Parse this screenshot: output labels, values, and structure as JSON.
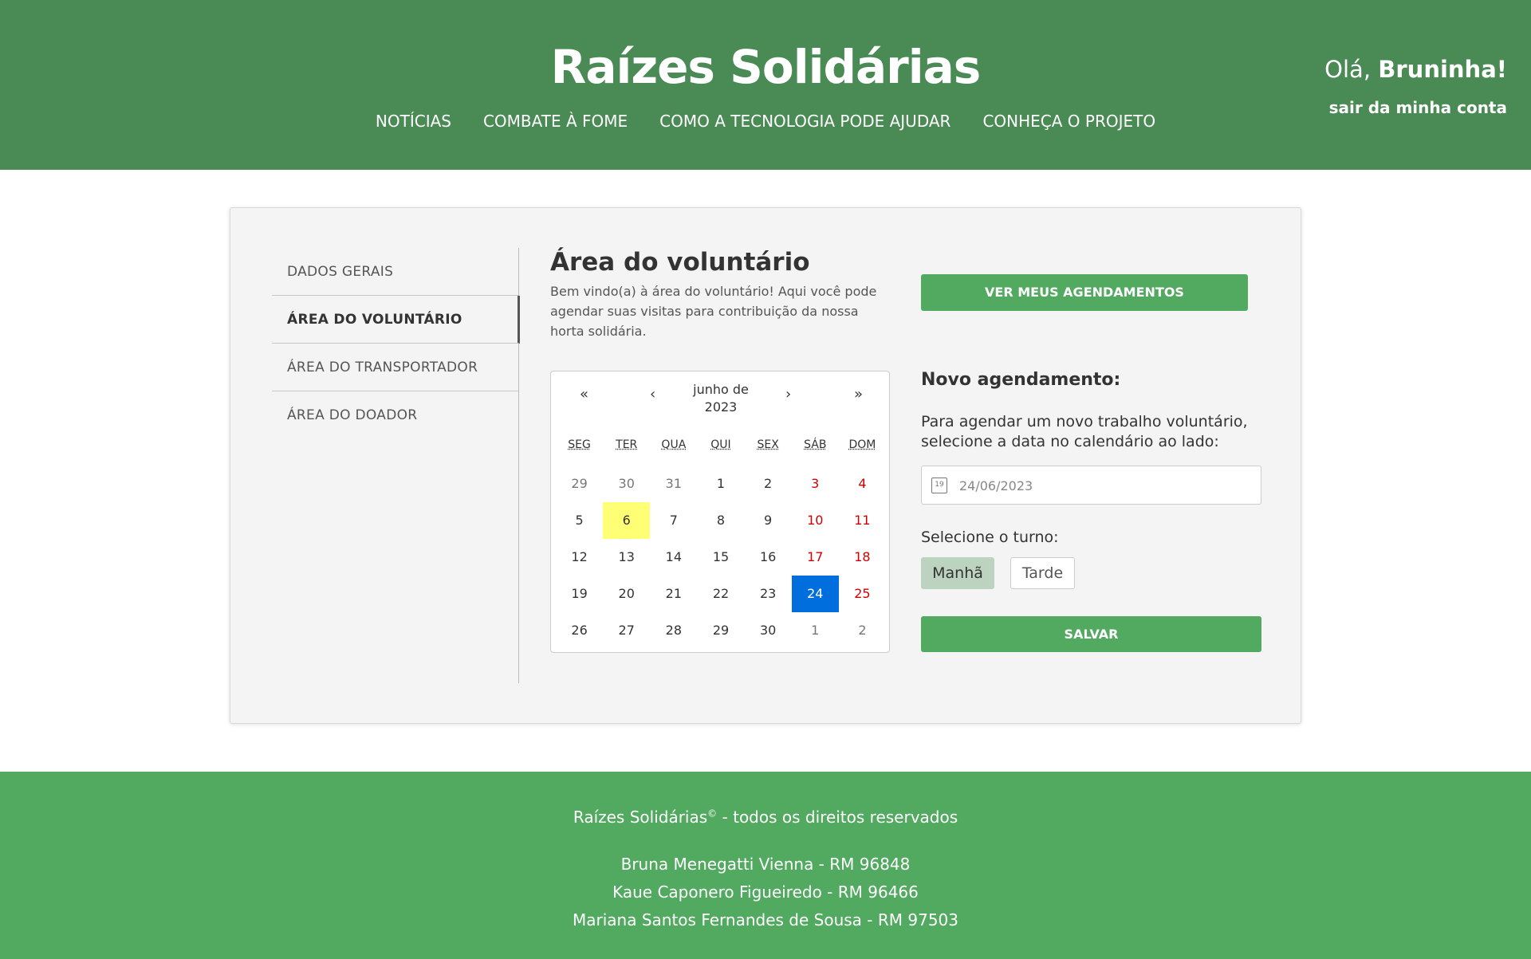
{
  "header": {
    "title": "Raízes Solidárias",
    "nav": [
      "NOTÍCIAS",
      "COMBATE À FOME",
      "COMO A TECNOLOGIA PODE AJUDAR",
      "CONHEÇA O PROJETO"
    ],
    "greeting_prefix": "Olá, ",
    "user_name": "Bruninha!",
    "logout": "sair da minha conta"
  },
  "sidebar": {
    "items": [
      {
        "label": "DADOS GERAIS",
        "active": false
      },
      {
        "label": "ÁREA DO VOLUNTÁRIO",
        "active": true
      },
      {
        "label": "ÁREA DO TRANSPORTADOR",
        "active": false
      },
      {
        "label": "ÁREA DO DOADOR",
        "active": false
      }
    ]
  },
  "main": {
    "title": "Área do voluntário",
    "intro": "Bem vindo(a) à área do voluntário! Aqui você pode agendar suas visitas para contribuição da nossa horta solidária.",
    "ver_agendamentos": "VER MEUS AGENDAMENTOS"
  },
  "calendar": {
    "nav": {
      "prev2": "«",
      "prev": "‹",
      "next": "›",
      "next2": "»"
    },
    "month_label": "junho de 2023",
    "weekdays": [
      "SEG",
      "TER",
      "QUA",
      "QUI",
      "SEX",
      "SÁB",
      "DOM"
    ],
    "weeks": [
      [
        "29",
        "30",
        "31",
        "1",
        "2",
        "3",
        "4"
      ],
      [
        "5",
        "6",
        "7",
        "8",
        "9",
        "10",
        "11"
      ],
      [
        "12",
        "13",
        "14",
        "15",
        "16",
        "17",
        "18"
      ],
      [
        "19",
        "20",
        "21",
        "22",
        "23",
        "24",
        "25"
      ],
      [
        "26",
        "27",
        "28",
        "29",
        "30",
        "1",
        "2"
      ]
    ],
    "today": "6",
    "selected": "24"
  },
  "form": {
    "heading": "Novo agendamento:",
    "instructions": "Para agendar um novo trabalho voluntário, selecione a data no calendário ao lado:",
    "date_value": "24/06/2023",
    "date_icon_text": "19",
    "turno_label": "Selecione o turno:",
    "turno_options": [
      "Manhã",
      "Tarde"
    ],
    "turno_selected": "Manhã",
    "save": "SALVAR"
  },
  "footer": {
    "copyright_name": "Raízes Solidárias",
    "copyright_symbol": "©",
    "copyright_rest": " - todos os direitos reservados",
    "authors": [
      "Bruna Menegatti Vienna - RM 96848",
      "Kaue Caponero Figueiredo - RM 96466",
      "Mariana Santos Fernandes de Sousa - RM 97503"
    ]
  },
  "colors": {
    "header_bg": "#4a8a54",
    "footer_bg": "#52a960",
    "button_green": "#52a960",
    "today_highlight": "#ffff76",
    "selected_day": "#006edc",
    "weekend_text": "#d10000"
  }
}
